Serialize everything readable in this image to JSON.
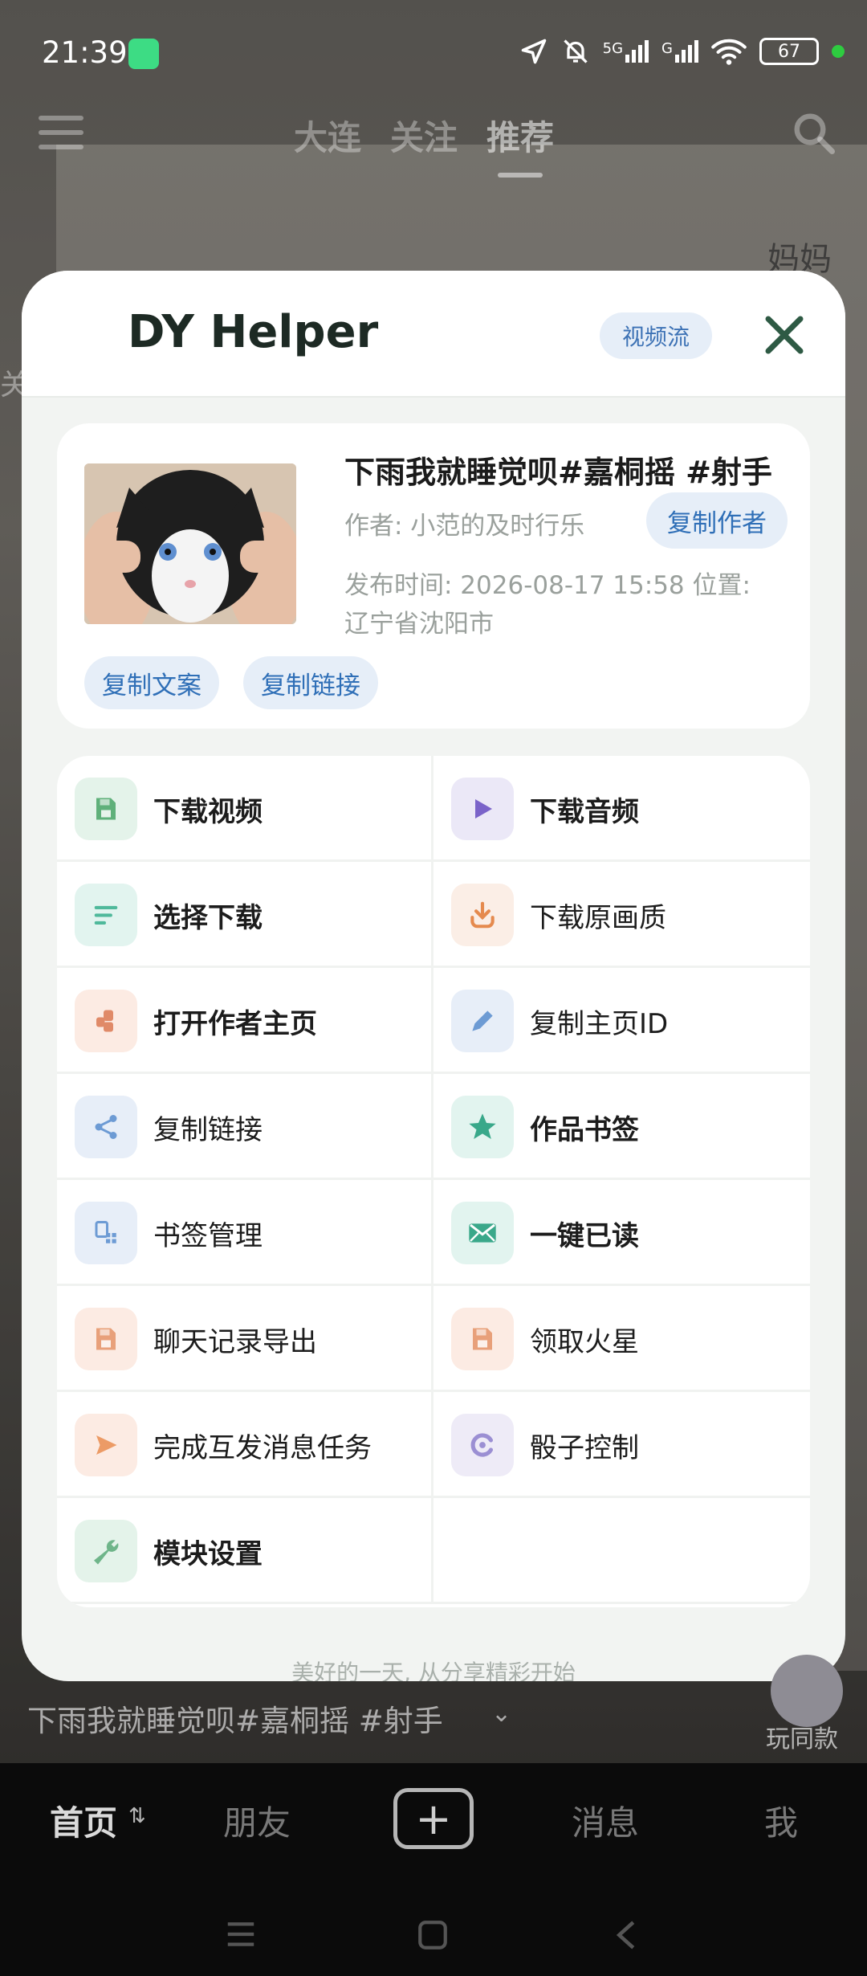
{
  "status_bar": {
    "time": "21:39",
    "signal_label": "5G",
    "signal_label_2": "G",
    "battery": "67"
  },
  "feed_nav": {
    "tabs": [
      "大连",
      "关注",
      "推荐"
    ],
    "active_tab": "推荐",
    "side_text": "妈妈",
    "left_text": "关注"
  },
  "helper": {
    "title": "DY Helper",
    "mode_badge": "视频流",
    "video": {
      "title": "下雨我就睡觉呗#嘉桐摇 #射手",
      "author": "作者: 小范的及时行乐",
      "copy_author": "复制作者",
      "publish_line": "发布时间: 2026-08-17 15:58  位置:",
      "location": "辽宁省沈阳市",
      "copy_text": "复制文案",
      "copy_link": "复制链接"
    },
    "actions": [
      {
        "label": "下载视频",
        "icon": "save-icon",
        "bold": true,
        "bg": "#e4f3ea",
        "fg": "#5fb07a"
      },
      {
        "label": "下载音频",
        "icon": "play-icon",
        "bold": true,
        "bg": "#ebe8f7",
        "fg": "#7a63c9"
      },
      {
        "label": "选择下载",
        "icon": "list-icon",
        "bold": true,
        "bg": "#e2f4ef",
        "fg": "#4fb99b"
      },
      {
        "label": "下载原画质",
        "icon": "download-icon",
        "bold": false,
        "bg": "#fbeee6",
        "fg": "#e58a4e"
      },
      {
        "label": "打开作者主页",
        "icon": "person-icon",
        "bold": true,
        "bg": "#fcebe3",
        "fg": "#e08a68"
      },
      {
        "label": "复制主页ID",
        "icon": "pencil-icon",
        "bold": false,
        "bg": "#e7eef8",
        "fg": "#6d9bd4"
      },
      {
        "label": "复制链接",
        "icon": "share-icon",
        "bold": false,
        "bg": "#e7eef8",
        "fg": "#6d9bd4"
      },
      {
        "label": "作品书签",
        "icon": "star-icon",
        "bold": true,
        "bg": "#e2f4ef",
        "fg": "#39a88a"
      },
      {
        "label": "书签管理",
        "icon": "bookmark-manage-icon",
        "bold": false,
        "bg": "#e7eef8",
        "fg": "#6d9bd4"
      },
      {
        "label": "一键已读",
        "icon": "mail-icon",
        "bold": true,
        "bg": "#e2f4ef",
        "fg": "#3aa88a"
      },
      {
        "label": "聊天记录导出",
        "icon": "save-icon",
        "bold": false,
        "bg": "#fcebe3",
        "fg": "#e8a07a"
      },
      {
        "label": "领取火星",
        "icon": "save-icon",
        "bold": false,
        "bg": "#fcebe3",
        "fg": "#e8a07a"
      },
      {
        "label": "完成互发消息任务",
        "icon": "send-icon",
        "bold": false,
        "bg": "#fcebe3",
        "fg": "#ec9b66"
      },
      {
        "label": "骰子控制",
        "icon": "dice-icon",
        "bold": false,
        "bg": "#eeebf7",
        "fg": "#9b8fd3"
      },
      {
        "label": "模块设置",
        "icon": "wrench-icon",
        "bold": true,
        "bg": "#e4f3ea",
        "fg": "#6fb58a"
      },
      {
        "label": "",
        "icon": "",
        "bold": false,
        "bg": "",
        "fg": ""
      }
    ],
    "footer": "美好的一天, 从分享精彩开始"
  },
  "video_overlay": {
    "caption": "下雨我就睡觉呗#嘉桐摇 #射手",
    "play_same": "玩同款"
  },
  "bottom_tabs": {
    "home": "首页",
    "friends": "朋友",
    "messages": "消息",
    "me": "我"
  }
}
